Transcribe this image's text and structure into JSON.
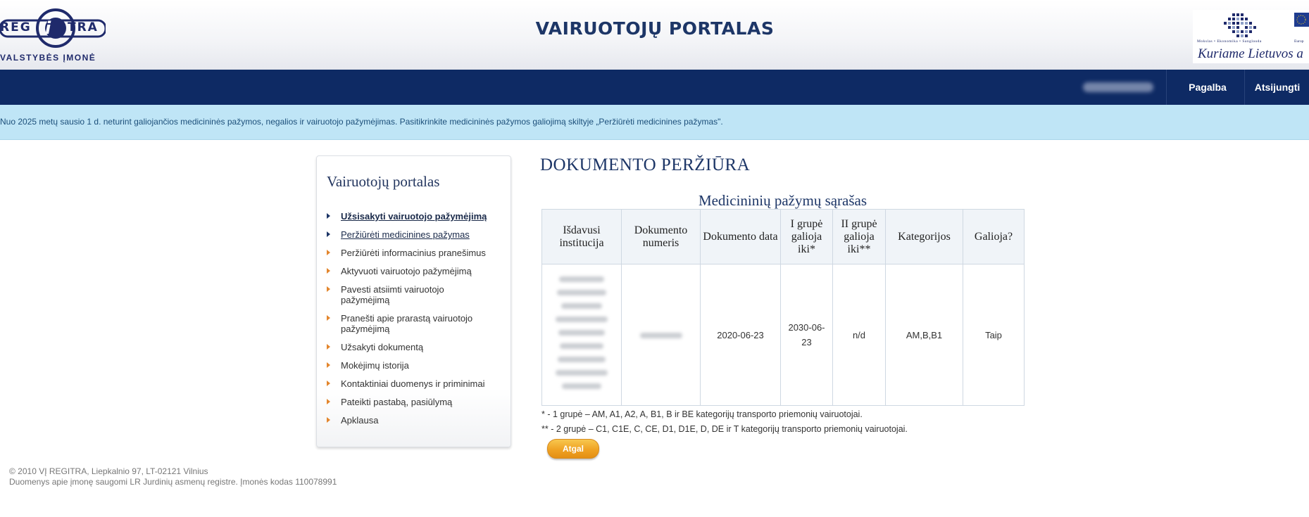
{
  "header": {
    "logo_left": "REG",
    "logo_i": "i",
    "logo_right": "TRA",
    "logo_subtitle": "VALSTYBĖS ĮMONĖ",
    "site_title": "VAIRUOTOJŲ PORTALAS",
    "eu_small_text": "Mokslas • Ekonomika • Sanglauda",
    "eu_motto": "Kuriame Lietuvos a",
    "eu_small_text2": "Europ"
  },
  "nav": {
    "help": "Pagalba",
    "logout": "Atsijungti"
  },
  "notice": "Nuo 2025 metų sausio 1 d. neturint galiojančios medicininės pažymos, negalios ir vairuotojo pažymėjimas. Pasitikrinkite medicininės pažymos galiojimą skiltyje „Peržiūrėti medicinines pažymas\".",
  "sidebar": {
    "title": "Vairuotojų portalas",
    "items": [
      {
        "label": "Užsisakyti vairuotojo pažymėjimą"
      },
      {
        "label": "Peržiūrėti medicinines pažymas"
      },
      {
        "label": "Peržiūrėti informacinius pranešimus"
      },
      {
        "label": "Aktyvuoti vairuotojo pažymėjimą"
      },
      {
        "label": "Pavesti atsiimti vairuotojo pažymėjimą"
      },
      {
        "label": "Pranešti apie prarastą vairuotojo pažymėjimą"
      },
      {
        "label": "Užsakyti dokumentą"
      },
      {
        "label": "Mokėjimų istorija"
      },
      {
        "label": "Kontaktiniai duomenys ir priminimai"
      },
      {
        "label": "Pateikti pastabą, pasiūlymą"
      },
      {
        "label": "Apklausa"
      }
    ]
  },
  "main": {
    "heading": "DOKUMENTO PERŽIŪRA",
    "table_caption": "Medicininių pažymų sąrašas",
    "columns": [
      "Išdavusi institucija",
      "Dokumento numeris",
      "Dokumento data",
      "I grupė galioja iki*",
      "II grupė galioja iki**",
      "Kategorijos",
      "Galioja?"
    ],
    "row": {
      "date": "2020-06-23",
      "group1_valid_until": "2030-06-23",
      "group2_valid_until": "n/d",
      "categories": "AM,B,B1",
      "valid": "Taip"
    },
    "footnote1": "* - 1 grupė – AM, A1, A2, A, B1, B ir BE kategorijų transporto priemonių vairuotojai.",
    "footnote2": "** - 2 grupė – C1, C1E, C, CE, D1, D1E, D, DE ir T kategorijų transporto priemonių vairuotojai.",
    "back_button": "Atgal"
  },
  "footer": {
    "line1": "© 2010 VĮ REGITRA, Liepkalnio 97, LT-02121 Vilnius",
    "line2": "Duomenys apie įmonę saugomi LR Jurdinių asmenų registre. Įmonės kodas 110078991"
  },
  "colors": {
    "navbar": "#0e2a64",
    "notice_bg": "#bfe5f6",
    "accent_orange": "#efa223",
    "title_blue": "#1d3667"
  }
}
